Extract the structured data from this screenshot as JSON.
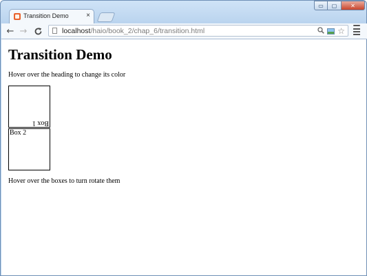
{
  "window": {
    "controls": {
      "minimize": "▭",
      "maximize": "▢",
      "close": "✕"
    }
  },
  "tab": {
    "title": "Transition Demo",
    "close_label": "×",
    "favicon": "html-file-icon"
  },
  "toolbar": {
    "back": "←",
    "forward": "→",
    "reload": "C",
    "url_host": "localhost",
    "url_path": "/haio/book_2/chap_6/transition.html",
    "search_icon": "🔍",
    "star_icon": "☆"
  },
  "page": {
    "heading": "Transition Demo",
    "intro": "Hover over the heading to change its color",
    "boxes": [
      {
        "label": "Box 1",
        "rotated": true
      },
      {
        "label": "Box 2",
        "rotated": false
      }
    ],
    "footer": "Hover over the boxes to turn rotate them"
  },
  "colors": {
    "frame": "#b9d3ee",
    "toolbar": "#f4f8fc",
    "favicon": "#e9622d",
    "menu_badge": "#3c9b3c"
  }
}
